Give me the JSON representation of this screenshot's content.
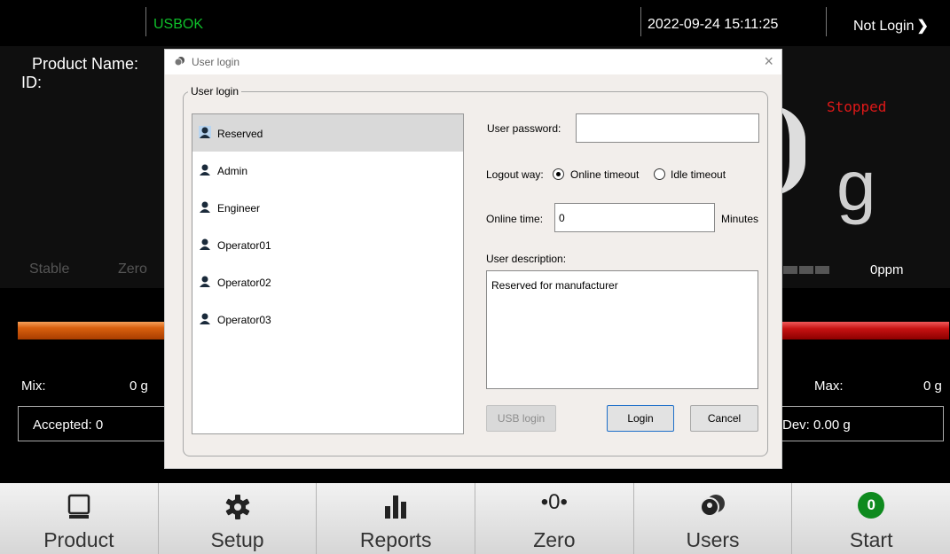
{
  "status_bar": {
    "usb": "USBOK",
    "datetime": "2022-09-24 15:11:25",
    "login_status": "Not Login",
    "login_chevron": "❯"
  },
  "background": {
    "product_name_label": "Product Name:",
    "id_label": "ID:",
    "run_state": "Stopped",
    "weight_unit": "g",
    "stable_label": "Stable",
    "zero_label": "Zero",
    "ppm": "0ppm",
    "mix_label": "Mix:",
    "mix_value": "0 g",
    "max_label": "Max:",
    "max_value": "0 g",
    "accepted": "Accepted: 0",
    "dev": "Dev: 0.00 g"
  },
  "nav": {
    "items": [
      {
        "label": "Product",
        "icon": "product-icon"
      },
      {
        "label": "Setup",
        "icon": "gear-icon"
      },
      {
        "label": "Reports",
        "icon": "bar-chart-icon"
      },
      {
        "label": "Zero",
        "icon": "zero-icon"
      },
      {
        "label": "Users",
        "icon": "users-icon"
      },
      {
        "label": "Start",
        "icon": "start-icon"
      }
    ],
    "zero_glyph": "•0•",
    "start_glyph": "0"
  },
  "dialog": {
    "title": "User login",
    "close_glyph": "×",
    "group_label": "User login",
    "users": [
      {
        "name": "Reserved",
        "selected": true
      },
      {
        "name": "Admin",
        "selected": false
      },
      {
        "name": "Engineer",
        "selected": false
      },
      {
        "name": "Operator01",
        "selected": false
      },
      {
        "name": "Operator02",
        "selected": false
      },
      {
        "name": "Operator03",
        "selected": false
      }
    ],
    "password_label": "User password:",
    "password_value": "",
    "logout_way_label": "Logout way:",
    "logout_options": [
      {
        "label": "Online timeout",
        "checked": true
      },
      {
        "label": "Idle timeout",
        "checked": false
      }
    ],
    "online_time_label": "Online time:",
    "online_time_value": "0",
    "online_time_unit": "Minutes",
    "description_label": "User description:",
    "description_value": "Reserved for manufacturer",
    "usb_login_button": "USB login",
    "login_button": "Login",
    "cancel_button": "Cancel"
  },
  "colors": {
    "usb_ok": "#0fbf2a",
    "stopped": "#e01818",
    "start_green": "#0e8a1e",
    "login_button_border": "#1e6fc9"
  }
}
